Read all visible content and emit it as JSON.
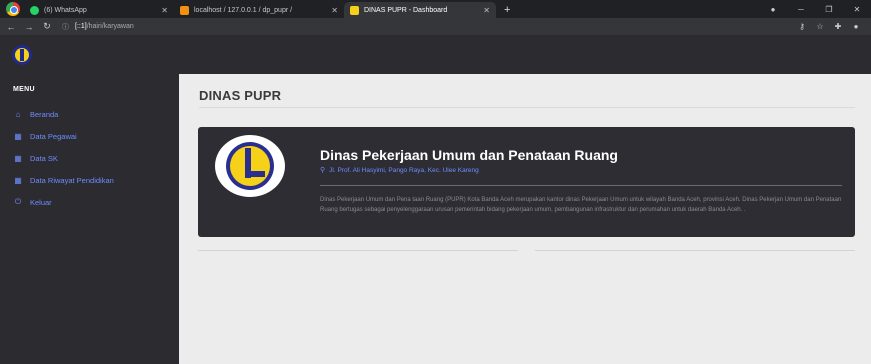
{
  "browser": {
    "tabs": [
      {
        "label": "(6) WhatsApp",
        "fav_color": "#25d366",
        "active": false
      },
      {
        "label": "localhost / 127.0.0.1 / dp_pupr / ",
        "fav_color": "#f29111",
        "active": false
      },
      {
        "label": "DINAS PUPR - Dashboard",
        "fav_color": "#f6d11a",
        "active": true
      }
    ],
    "url_host": "[::1]",
    "url_path": "/hairi/karyawan"
  },
  "sidebar": {
    "menu_title": "MENU",
    "items": [
      {
        "label": "Beranda",
        "icon": "home-icon"
      },
      {
        "label": "Data Pegawai",
        "icon": "table-icon"
      },
      {
        "label": "Data SK",
        "icon": "table-icon"
      },
      {
        "label": "Data Riwayat Pendidikan",
        "icon": "table-icon"
      },
      {
        "label": "Keluar",
        "icon": "power-icon"
      }
    ]
  },
  "main": {
    "page_title": "DINAS PUPR",
    "card": {
      "title": "Dinas Pekerjaan Umum dan Penataan Ruang",
      "address": "Jl. Prof. Ali Hasyimi, Pango Raya, Kec. Ulee Kareng",
      "description": "Dinas Pekerjaan Umum dan Pena taan Ruang (PUPR) Kota Banda Aceh merupakan kantor dinas Pekerjaan Umum untuk wilayah Banda Aceh, provinsi Aceh. Dinas Pekerjan Umum dan Penataan Ruang bertugas sebagai penyelenggaraan urusan pemerintah bidang pekerjaan umum, pembangunan infrastruktur dan perumahan untuk daerah Banda Aceh. ."
    }
  },
  "colors": {
    "sidebar_bg": "#2b2b30",
    "accent": "#6f8cff",
    "card_bg": "#2d2d33",
    "main_bg": "#ececec"
  }
}
